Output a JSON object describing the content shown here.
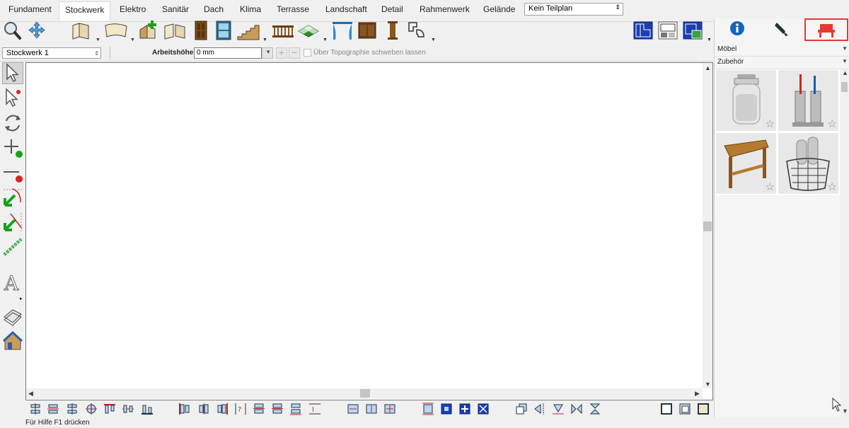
{
  "tabs": [
    {
      "label": "Fundament"
    },
    {
      "label": "Stockwerk"
    },
    {
      "label": "Elektro"
    },
    {
      "label": "Sanitär"
    },
    {
      "label": "Dach"
    },
    {
      "label": "Klima"
    },
    {
      "label": "Terrasse"
    },
    {
      "label": "Landschaft"
    },
    {
      "label": "Detail"
    },
    {
      "label": "Rahmenwerk"
    },
    {
      "label": "Gelände"
    }
  ],
  "active_tab": "Stockwerk",
  "teilplan": {
    "value": "Kein Teilplan"
  },
  "toolbar": {
    "icons": [
      "zoom-icon",
      "pan-icon",
      "wall-icon",
      "curved-wall-icon",
      "add-room-icon",
      "split-wall-icon",
      "door-icon",
      "window-icon",
      "stairs-icon",
      "railing-icon",
      "floor-tile-icon",
      "curtain-icon",
      "cabinet-icon",
      "column-icon",
      "shape-icon",
      "plan-view-icon",
      "elevation-view-icon",
      "3d-view-icon"
    ]
  },
  "options": {
    "storey_select": "Stockwerk 1",
    "height_label": "Arbeitshöhe:",
    "height_value": "0 mm",
    "topo_label": "Über Topographie schweben lassen",
    "topo_checked": false
  },
  "left_tools": [
    "select-arrow-icon",
    "select-special-icon",
    "rotate-icon",
    "add-point-icon",
    "remove-point-icon",
    "trim-icon",
    "extend-icon",
    "dimension-icon",
    "text-icon",
    "layer-icon",
    "house-icon"
  ],
  "status": {
    "help_text": "Für Hilfe F1 drücken"
  },
  "right_panel": {
    "tabs": [
      "info-icon",
      "pen-icon",
      "furniture-icon"
    ],
    "active_tab": "furniture-icon",
    "category": "Möbel",
    "subcategory": "Zubehör",
    "gallery": [
      {
        "name": "glass-jar-icon"
      },
      {
        "name": "utensil-holder-icon"
      },
      {
        "name": "corner-table-icon"
      },
      {
        "name": "wire-basket-icon"
      }
    ]
  },
  "colors": {
    "accent_red": "#e53935",
    "canvas_bg": "#ffffff",
    "chrome_bg": "#f0f0f0",
    "icon_blue": "#1565c0"
  }
}
